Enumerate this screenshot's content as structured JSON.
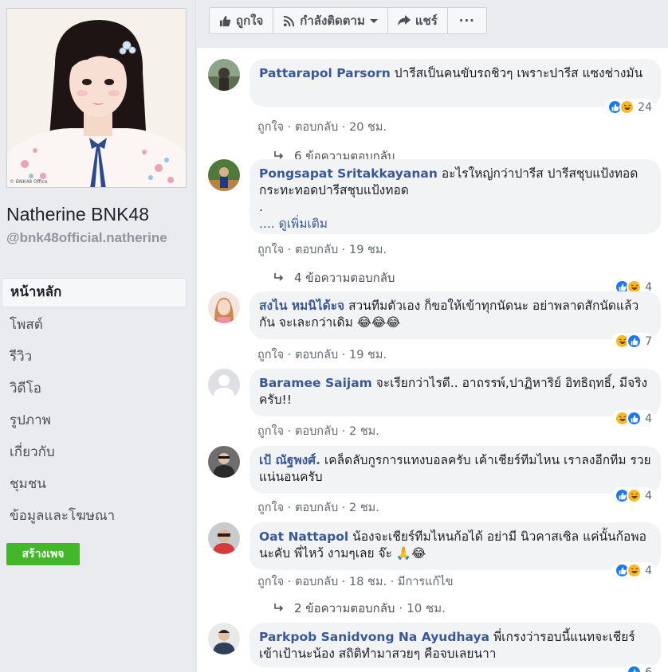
{
  "sidebar": {
    "page_name": "Natherine BNK48",
    "handle": "@bnk48official.natherine",
    "photo_watermark": "© BNK48 Office",
    "nav": [
      {
        "label": "หน้าหลัก"
      },
      {
        "label": "โพสต์"
      },
      {
        "label": "รีวิว"
      },
      {
        "label": "วิดีโอ"
      },
      {
        "label": "รูปภาพ"
      },
      {
        "label": "เกี่ยวกับ"
      },
      {
        "label": "ชุมชน"
      },
      {
        "label": "ข้อมูลและโฆษณา"
      }
    ],
    "create_page_label": "สร้างเพจ"
  },
  "actions": {
    "like": "ถูกใจ",
    "following": "กำลังติดตาม",
    "share": "แชร์",
    "more": "···"
  },
  "comments": [
    {
      "author": "Pattarapol Parsorn",
      "text": "ปารีสเป็นคนขับรถชิวๆ เพราะปารีส แซงช่างมัน",
      "like": "ถูกใจ",
      "reply": "ตอบกลับ",
      "time": "20 ชม.",
      "react_count": "24",
      "replies_label": "6 ข้อความตอบกลับ"
    },
    {
      "author": "Pongsapat Sritakkayanan",
      "text": "อะไรใหญ่กว่าปารีส ปารีสชุบแป้งทอด กระทะทอดปารีสชุบแป้งทอด",
      "dot": ".",
      "see_more": ".... ดูเพิ่มเติม",
      "like": "ถูกใจ",
      "reply": "ตอบกลับ",
      "time": "19 ชม.",
      "react_count": "4",
      "replies_label": "4 ข้อความตอบกลับ"
    },
    {
      "author": "สงไน หมนิได้ะจ",
      "text": "สวนทีมตัวเอง ก็ขอให้เข้าทุกนัดนะ อย่าพลาดสักนัดแล้วกัน จะเละกว่าเดิม 😂😂😂",
      "like": "ถูกใจ",
      "reply": "ตอบกลับ",
      "time": "19 ชม.",
      "react_count": "7"
    },
    {
      "author": "Baramee Saijam",
      "text": "จะเรียกว่าไรดี.. อาถรรพ์,ปาฏิหาริย์ อิทธิฤทธิ์, มีจริงครับ!!",
      "like": "ถูกใจ",
      "reply": "ตอบกลับ",
      "time": "2 ชม.",
      "react_count": "4"
    },
    {
      "author": "เป้ ณัฐพงศ์.",
      "text": "เคล็ดลับกูรการแทงบอลครับ เค้าเชียร์ทีมไหน เราลงอีกทีม รวยแน่นอนครับ",
      "like": "ถูกใจ",
      "reply": "ตอบกลับ",
      "time": "2 ชม.",
      "react_count": "4"
    },
    {
      "author": "Oat Nattapol",
      "text": "น้องจะเชียร์ทีมไหนก้อได้ อย่ามี นิวคาสเซิล แค่นั้นก้อพอ นะคับ พี่ไหว้ งามๆเลย จ๊ะ 🙏😂",
      "like": "ถูกใจ",
      "reply": "ตอบกลับ",
      "time": "18 ชม.",
      "edited": "มีการแก้ไข",
      "react_count": "4",
      "replies_label": "2 ข้อความตอบกลับ",
      "replies_time": "10 ชม."
    },
    {
      "author": "Parkpob Sanidvong Na Ayudhaya",
      "text": "พี่เกรงว่ารอบนี้แนทจะเชียร์เข้าเป้านะน้อง สถิติทำมาสวยๆ คือจบเลยนาา",
      "react_count": "6"
    }
  ],
  "colors": {
    "link": "#385898",
    "like_blue": "#1877f2",
    "haha_yellow": "#f7b928",
    "create_green": "#42b72a"
  }
}
